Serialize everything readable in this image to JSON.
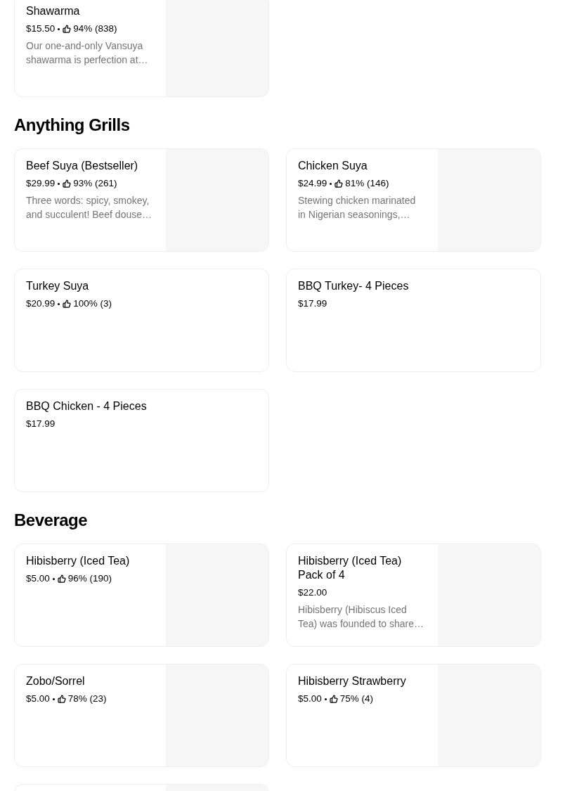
{
  "sections": [
    {
      "items": [
        {
          "name": "Shawarma",
          "price": "$15.50",
          "rating": "94% (838)",
          "description": "Our one-and-only Vansuya\nshawarma is perfection at…",
          "image": {
            "kind": "picture"
          }
        }
      ]
    },
    {
      "title": "Anything Grills",
      "items": [
        {
          "name": "Beef Suya (Bestseller)",
          "price": "$29.99",
          "rating": "93% (261)",
          "description": "Three words: spicy, smokey,\nand succulent! Beef douse…",
          "image": {
            "kind": "picture"
          }
        },
        {
          "name": "Chicken Suya",
          "price": "$24.99",
          "rating": "81% (146)",
          "description": "Stewing chicken marinated\nin Nigerian seasonings,…",
          "image": {
            "kind": "picture"
          }
        },
        {
          "name": "Turkey Suya",
          "price": "$20.99",
          "rating": "100% (3)"
        },
        {
          "name": "BBQ Turkey- 4 Pieces",
          "price": "$17.99"
        },
        {
          "name": "BBQ Chicken - 4 Pieces",
          "price": "$17.99"
        }
      ]
    },
    {
      "title": "Beverage",
      "items": [
        {
          "name": "Hibisberry (Iced Tea)",
          "price": "$5.00",
          "rating": "96% (190)",
          "image": {
            "kind": "picture"
          }
        },
        {
          "name": "Hibisberry (Iced Tea) Pack of 4",
          "price": "$22.00",
          "description": "Hibisberry (Hibiscus Iced\nTea) was founded to share…",
          "image": {
            "kind": "picture"
          }
        },
        {
          "name": "Zobo/Sorrel",
          "price": "$5.00",
          "rating": "78% (23)",
          "image": {
            "kind": "picture"
          }
        },
        {
          "name": "Hibisberry Strawberry",
          "price": "$5.00",
          "rating": "75% (4)",
          "image": {
            "kind": "picture"
          }
        },
        {
          "image": {
            "kind": "picture"
          }
        }
      ]
    }
  ]
}
